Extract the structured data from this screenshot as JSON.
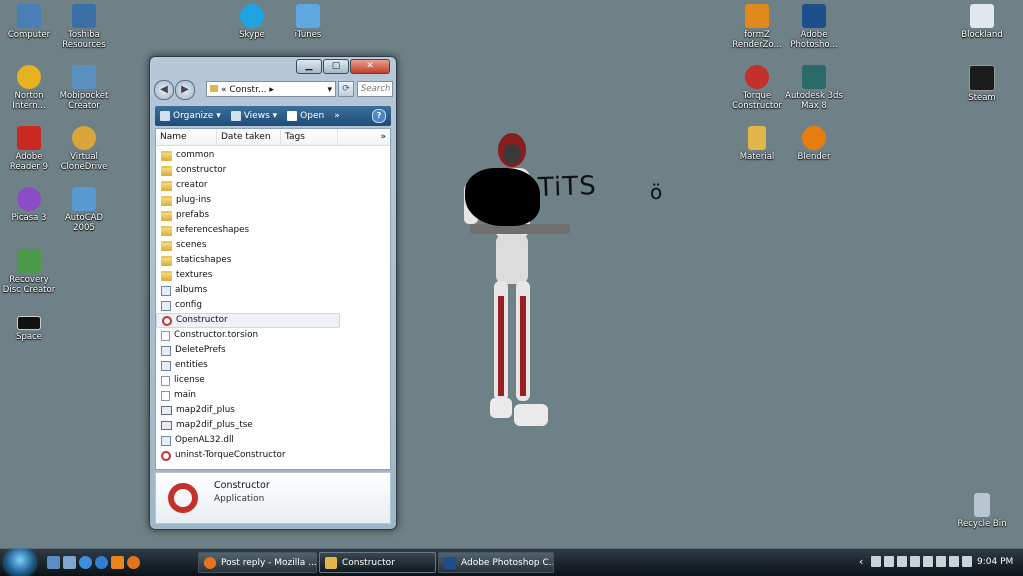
{
  "desktop_icons": [
    {
      "label": "Computer",
      "icon": "computer-icon",
      "color": "#4a7fb5"
    },
    {
      "label": "Toshiba Resources",
      "icon": "toshiba-icon",
      "color": "#3a6fa8"
    },
    {
      "label": "Norton Intern...",
      "icon": "norton-icon",
      "color": "#e6b21e"
    },
    {
      "label": "Mobipocket Creator",
      "icon": "mobipocket-icon",
      "color": "#5a8fbf"
    },
    {
      "label": "Adobe Reader 9",
      "icon": "adobe-reader-icon",
      "color": "#c82a22"
    },
    {
      "label": "Virtual CloneDrive",
      "icon": "clonedrive-icon",
      "color": "#d8a63a"
    },
    {
      "label": "Picasa 3",
      "icon": "picasa-icon",
      "color": "#8b4cc7"
    },
    {
      "label": "AutoCAD 2005",
      "icon": "autocad-icon",
      "color": "#5a9ad2"
    },
    {
      "label": "Recovery Disc Creator",
      "icon": "recovery-icon",
      "color": "#4a9a4a"
    },
    {
      "label": "Space",
      "icon": "space-icon",
      "color": "#111111"
    },
    {
      "label": "Skype",
      "icon": "skype-icon",
      "color": "#1fa3e3"
    },
    {
      "label": "iTunes",
      "icon": "itunes-icon",
      "color": "#5fa9e0"
    },
    {
      "label": "formZ RenderZo...",
      "icon": "formz-icon",
      "color": "#e08a1e"
    },
    {
      "label": "Adobe Photosho...",
      "icon": "photoshop-icon",
      "color": "#1c4f8c"
    },
    {
      "label": "Torque Constructor",
      "icon": "torque-icon",
      "color": "#c4302b"
    },
    {
      "label": "Autodesk 3ds Max 8",
      "icon": "3dsmax-icon",
      "color": "#2a6a6a"
    },
    {
      "label": "Material",
      "icon": "folder-icon",
      "color": "#e2b64a"
    },
    {
      "label": "Blender",
      "icon": "blender-icon",
      "color": "#e87d0d"
    },
    {
      "label": "Blockland",
      "icon": "blockland-icon",
      "color": "#dfe6ec"
    },
    {
      "label": "Steam",
      "icon": "steam-icon",
      "color": "#1b1b1b"
    },
    {
      "label": "Recycle Bin",
      "icon": "recycle-bin-icon",
      "color": "#b8c6d0"
    }
  ],
  "explorer": {
    "address": "«  Constr...  ▸",
    "search_placeholder": "Search",
    "toolbar": {
      "organize": "Organize",
      "views": "Views",
      "open": "Open",
      "more": "»",
      "help": "?"
    },
    "columns": [
      "Name",
      "Date taken",
      "Tags",
      "»"
    ],
    "files": [
      {
        "name": "common",
        "type": "folder"
      },
      {
        "name": "constructor",
        "type": "folder"
      },
      {
        "name": "creator",
        "type": "folder"
      },
      {
        "name": "plug-ins",
        "type": "folder"
      },
      {
        "name": "prefabs",
        "type": "folder"
      },
      {
        "name": "referenceshapes",
        "type": "folder"
      },
      {
        "name": "scenes",
        "type": "folder"
      },
      {
        "name": "staticshapes",
        "type": "folder"
      },
      {
        "name": "textures",
        "type": "folder"
      },
      {
        "name": "albums",
        "type": "cfg"
      },
      {
        "name": "config",
        "type": "cfg"
      },
      {
        "name": "Constructor",
        "type": "gear",
        "selected": true
      },
      {
        "name": "Constructor.torsion",
        "type": "doc"
      },
      {
        "name": "DeletePrefs",
        "type": "cfg"
      },
      {
        "name": "entities",
        "type": "cfg"
      },
      {
        "name": "license",
        "type": "doc"
      },
      {
        "name": "main",
        "type": "doc"
      },
      {
        "name": "map2dif_plus",
        "type": "app"
      },
      {
        "name": "map2dif_plus_tse",
        "type": "app"
      },
      {
        "name": "OpenAL32.dll",
        "type": "cfg"
      },
      {
        "name": "uninst-TorqueConstructor",
        "type": "gear"
      }
    ],
    "details": {
      "name": "Constructor",
      "kind": "Application"
    }
  },
  "handwriting": {
    "text1": "TiTS",
    "text2": "ö"
  },
  "taskbar": {
    "buttons": [
      {
        "label": "Post reply - Mozilla ...",
        "icon": "firefox-icon",
        "color": "#e8731e",
        "active": false
      },
      {
        "label": "Constructor",
        "icon": "folder-icon",
        "color": "#e2b64a",
        "active": true
      },
      {
        "label": "Adobe Photoshop C...",
        "icon": "photoshop-icon",
        "color": "#1c4f8c",
        "active": false
      }
    ],
    "tray_arrow": "‹",
    "clock": "9:04 PM"
  }
}
